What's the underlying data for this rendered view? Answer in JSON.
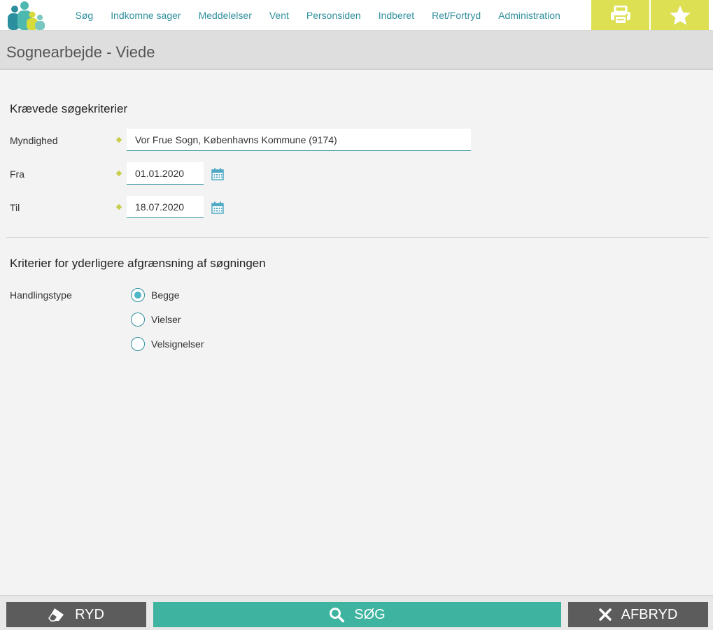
{
  "nav": {
    "items": [
      "Søg",
      "Indkomne sager",
      "Meddelelser",
      "Vent",
      "Personsiden",
      "Indberet",
      "Ret/Fortryd",
      "Administration"
    ],
    "print_icon": "print-icon",
    "favorite_icon": "star-icon",
    "accent_color": "#dde052",
    "link_color": "#2f8f9c"
  },
  "page": {
    "title": "Sognearbejde - Viede"
  },
  "required": {
    "heading": "Krævede søgekriterier",
    "authority": {
      "label": "Myndighed",
      "value": "Vor Frue Sogn, Københavns Kommune (9174)"
    },
    "from": {
      "label": "Fra",
      "value": "01.01.2020"
    },
    "to": {
      "label": "Til",
      "value": "18.07.2020"
    }
  },
  "optional": {
    "heading": "Kriterier for yderligere afgrænsning af søgningen",
    "action_type": {
      "label": "Handlingstype",
      "options": [
        "Begge",
        "Vielser",
        "Velsignelser"
      ],
      "selected": "Begge"
    }
  },
  "actions": {
    "clear": "RYD",
    "search": "SØG",
    "cancel": "AFBRYD",
    "search_color": "#3db3a0",
    "secondary_color": "#5c5c5c"
  }
}
